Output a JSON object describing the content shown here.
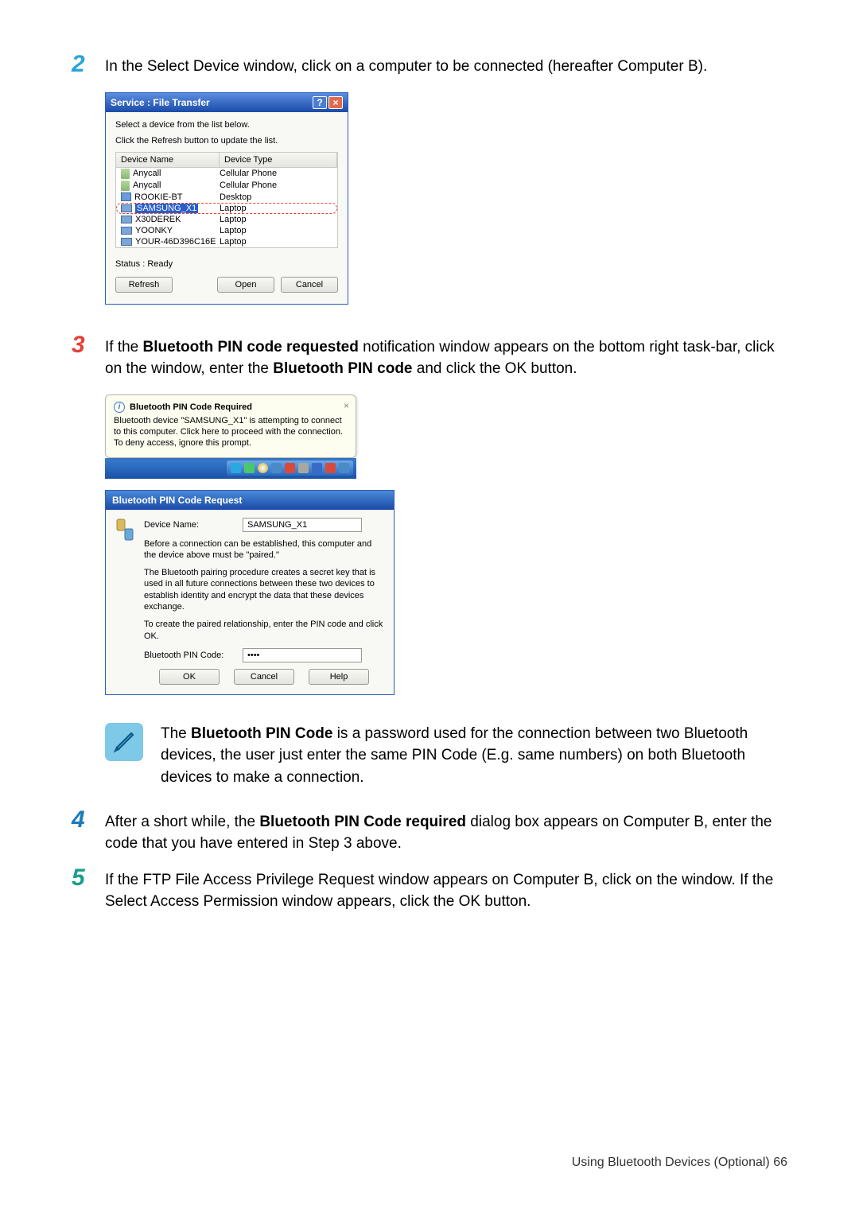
{
  "step2": {
    "num": "2",
    "text_before": "In the Select Device window, click on a computer to be connected (hereafter Computer B)."
  },
  "dlg1": {
    "title": "Service : File Transfer",
    "line1": "Select a device from the list below.",
    "line2": "Click the Refresh button to update the list.",
    "col_name": "Device Name",
    "col_type": "Device Type",
    "rows": [
      {
        "name": "Anycall",
        "type": "Cellular Phone",
        "icon": "phone"
      },
      {
        "name": "Anycall",
        "type": "Cellular Phone",
        "icon": "phone"
      },
      {
        "name": "ROOKIE-BT",
        "type": "Desktop",
        "icon": "desk"
      },
      {
        "name": "SAMSUNG_X1",
        "type": "Laptop",
        "icon": "lap",
        "selected": true
      },
      {
        "name": "X30DEREK",
        "type": "Laptop",
        "icon": "lap"
      },
      {
        "name": "YOONKY",
        "type": "Laptop",
        "icon": "lap"
      },
      {
        "name": "YOUR-46D396C16E",
        "type": "Laptop",
        "icon": "lap"
      }
    ],
    "status": "Status : Ready",
    "btn_refresh": "Refresh",
    "btn_open": "Open",
    "btn_cancel": "Cancel"
  },
  "step3": {
    "num": "3",
    "pre": "If the ",
    "bold1": "Bluetooth PIN code requested",
    "mid1": " notification window appears on the bottom right task-bar, click on the window, enter the ",
    "bold2": "Bluetooth PIN code",
    "mid2": " and click the OK button."
  },
  "notif": {
    "title": "Bluetooth PIN Code Required",
    "body": "Bluetooth device \"SAMSUNG_X1\" is attempting to connect to this computer.  Click here to proceed with the connection.  To deny access, ignore this prompt."
  },
  "dlg2": {
    "title": "Bluetooth PIN Code Request",
    "lbl_device": "Device Name:",
    "device_value": "SAMSUNG_X1",
    "p1": "Before a connection can be established, this computer and the device above must be \"paired.\"",
    "p2": "The Bluetooth pairing procedure creates a secret key that is used in all future connections between these two devices to establish identity and encrypt the data that these devices exchange.",
    "p3": "To create the paired relationship, enter the PIN code and click OK.",
    "lbl_pin": "Bluetooth PIN Code:",
    "pin_value": "••••",
    "btn_ok": "OK",
    "btn_cancel": "Cancel",
    "btn_help": "Help"
  },
  "note": {
    "pre": "The ",
    "bold": "Bluetooth PIN Code",
    "rest": " is a password used for the connection between two Bluetooth devices, the user just enter the same PIN Code (E.g. same numbers) on both Bluetooth devices to make a connection."
  },
  "step4": {
    "num": "4",
    "pre": "After a short while, the ",
    "bold": "Bluetooth PIN Code required",
    "rest": " dialog box appears on Computer B, enter the code that you have entered in Step 3 above."
  },
  "step5": {
    "num": "5",
    "text": "If the FTP File Access Privilege Request window appears on Computer B, click on the window. If the Select Access Permission window appears, click the OK button."
  },
  "footer": "Using Bluetooth Devices (Optional)    66"
}
